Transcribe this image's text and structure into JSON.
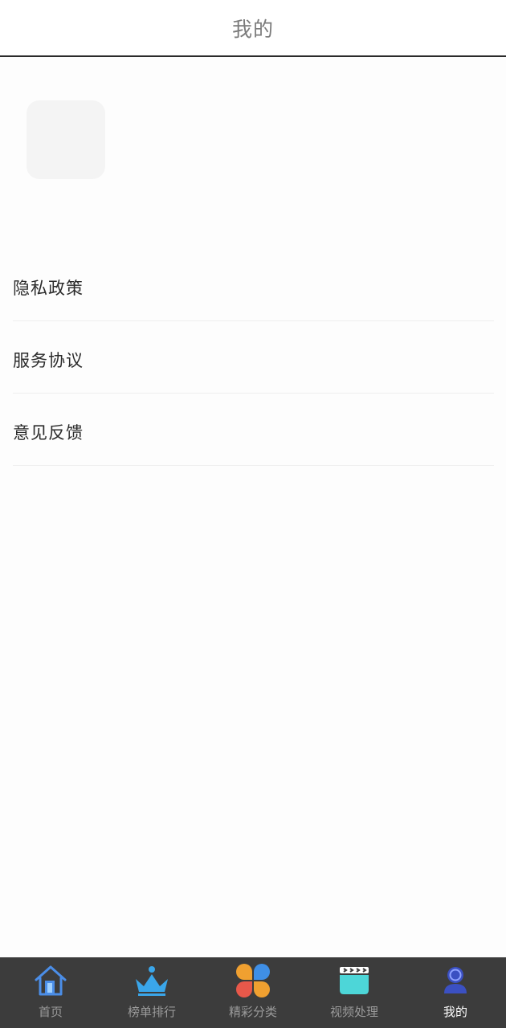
{
  "header": {
    "title": "我的"
  },
  "menu": {
    "items": [
      {
        "label": "隐私政策"
      },
      {
        "label": "服务协议"
      },
      {
        "label": "意见反馈"
      }
    ]
  },
  "tabbar": {
    "active_index": 4,
    "items": [
      {
        "label": "首页",
        "icon": "home-icon"
      },
      {
        "label": "榜单排行",
        "icon": "crown-icon"
      },
      {
        "label": "精彩分类",
        "icon": "category-icon"
      },
      {
        "label": "视频处理",
        "icon": "clapperboard-icon"
      },
      {
        "label": "我的",
        "icon": "profile-icon"
      }
    ]
  },
  "colors": {
    "tabbar_bg": "#3c3c3c",
    "tab_label": "#9a9a9a",
    "tab_label_active": "#ffffff",
    "header_title": "#7b7b7b"
  }
}
